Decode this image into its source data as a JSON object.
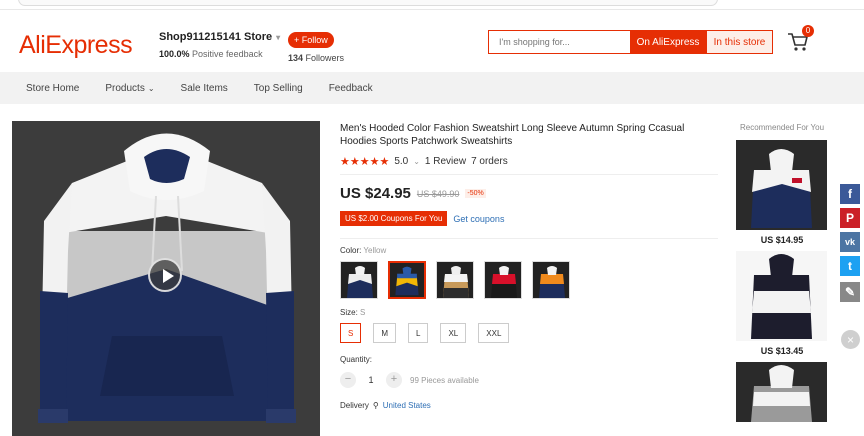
{
  "header": {
    "logo": "AliExpress",
    "store_name": "Shop911215141 Store",
    "feedback_pct": "100.0%",
    "feedback_label": "Positive feedback",
    "follow_label": "+ Follow",
    "followers_count": "134",
    "followers_label": "Followers",
    "search_placeholder": "I'm shopping for...",
    "search_on_ali": "On AliExpress",
    "search_in_store": "In this store",
    "cart_count": "0"
  },
  "nav": {
    "items": [
      "Store Home",
      "Products",
      "Sale Items",
      "Top Selling",
      "Feedback"
    ]
  },
  "product": {
    "title": "Men's Hooded Color Fashion Sweatshirt Long Sleeve Autumn Spring Ccasual Hoodies Sports Patchwork Sweatshirts",
    "stars": "★★★★★",
    "rating": "5.0",
    "reviews": "1 Review",
    "orders": "7 orders",
    "price": "US $24.95",
    "old_price": "US $49.90",
    "discount": "-50%",
    "coupon": "US $2.00 Coupons For You",
    "get_coupons": "Get coupons",
    "color_label": "Color:",
    "color_value": "Yellow",
    "size_label": "Size:",
    "size_value": "S",
    "sizes": [
      "S",
      "M",
      "L",
      "XL",
      "XXL"
    ],
    "quantity_label": "Quantity:",
    "quantity_value": "1",
    "quantity_minus": "−",
    "quantity_plus": "+",
    "available": "99 Pieces available",
    "delivery_label": "Delivery",
    "delivery_country": "United States"
  },
  "recommended": {
    "title": "Recommended For You",
    "items": [
      {
        "price": "US $14.95"
      },
      {
        "price": "US $13.45"
      }
    ]
  },
  "social": {
    "facebook": "f",
    "pinterest": "P",
    "vk": "vk",
    "twitter": "t",
    "close": "×"
  },
  "colors": {
    "accent": "#e62e04",
    "link": "#2e6fb5",
    "nav_bg": "#f2f2f2"
  }
}
